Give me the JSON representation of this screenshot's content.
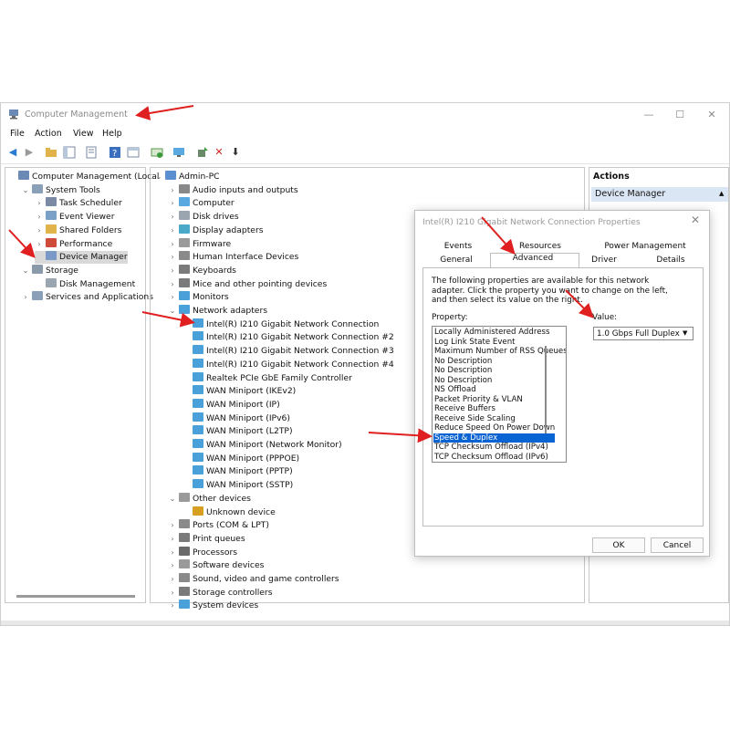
{
  "window": {
    "title": "Computer Management",
    "menu": [
      "File",
      "Action",
      "View",
      "Help"
    ],
    "controls": {
      "minimize": "—",
      "maximize": "☐",
      "close": "✕"
    }
  },
  "left_tree": [
    {
      "label": "Computer Management (Local",
      "indent": 0,
      "twisty": "",
      "icon": "computer-mgmt-icon",
      "color": "#6a8ab5"
    },
    {
      "label": "System Tools",
      "indent": 1,
      "twisty": "⌄",
      "icon": "tools-icon",
      "color": "#8aa0b8"
    },
    {
      "label": "Task Scheduler",
      "indent": 2,
      "twisty": "›",
      "icon": "clock-icon",
      "color": "#7a8aa5"
    },
    {
      "label": "Event Viewer",
      "indent": 2,
      "twisty": "›",
      "icon": "event-viewer-icon",
      "color": "#7aa0c8"
    },
    {
      "label": "Shared Folders",
      "indent": 2,
      "twisty": "›",
      "icon": "shared-folder-icon",
      "color": "#e0b44a"
    },
    {
      "label": "Performance",
      "indent": 2,
      "twisty": "›",
      "icon": "performance-icon",
      "color": "#d04a3a"
    },
    {
      "label": "Device Manager",
      "indent": 2,
      "twisty": "",
      "icon": "device-manager-icon",
      "color": "#7a9ac5",
      "selected": true
    },
    {
      "label": "Storage",
      "indent": 1,
      "twisty": "⌄",
      "icon": "storage-icon",
      "color": "#8a9aaa"
    },
    {
      "label": "Disk Management",
      "indent": 2,
      "twisty": "",
      "icon": "disk-icon",
      "color": "#9aa5b0"
    },
    {
      "label": "Services and Applications",
      "indent": 1,
      "twisty": "›",
      "icon": "services-icon",
      "color": "#8aa0b8"
    }
  ],
  "device_tree": [
    {
      "label": "Admin-PC",
      "indent": 0,
      "twisty": "⌄",
      "icon": "computer-icon",
      "color": "#5a8fd0"
    },
    {
      "label": "Audio inputs and outputs",
      "indent": 1,
      "twisty": "›",
      "icon": "audio-icon",
      "color": "#888"
    },
    {
      "label": "Computer",
      "indent": 1,
      "twisty": "›",
      "icon": "computer-icon",
      "color": "#5aa8e0"
    },
    {
      "label": "Disk drives",
      "indent": 1,
      "twisty": "›",
      "icon": "disk-icon",
      "color": "#9aa5b0"
    },
    {
      "label": "Display adapters",
      "indent": 1,
      "twisty": "›",
      "icon": "display-icon",
      "color": "#4aa8c8"
    },
    {
      "label": "Firmware",
      "indent": 1,
      "twisty": "›",
      "icon": "firmware-icon",
      "color": "#9a9a9a"
    },
    {
      "label": "Human Interface Devices",
      "indent": 1,
      "twisty": "›",
      "icon": "hid-icon",
      "color": "#8a8a8a"
    },
    {
      "label": "Keyboards",
      "indent": 1,
      "twisty": "›",
      "icon": "keyboard-icon",
      "color": "#7a7a7a"
    },
    {
      "label": "Mice and other pointing devices",
      "indent": 1,
      "twisty": "›",
      "icon": "mouse-icon",
      "color": "#7a7a7a"
    },
    {
      "label": "Monitors",
      "indent": 1,
      "twisty": "›",
      "icon": "monitor-icon",
      "color": "#4aa0d8"
    },
    {
      "label": "Network adapters",
      "indent": 1,
      "twisty": "⌄",
      "icon": "network-icon",
      "color": "#4aa0d8"
    },
    {
      "label": "Intel(R) I210 Gigabit Network Connection",
      "indent": 2,
      "twisty": "",
      "icon": "network-icon",
      "color": "#4aa0d8"
    },
    {
      "label": "Intel(R) I210 Gigabit Network Connection #2",
      "indent": 2,
      "twisty": "",
      "icon": "network-icon",
      "color": "#4aa0d8"
    },
    {
      "label": "Intel(R) I210 Gigabit Network Connection #3",
      "indent": 2,
      "twisty": "",
      "icon": "network-icon",
      "color": "#4aa0d8"
    },
    {
      "label": "Intel(R) I210 Gigabit Network Connection #4",
      "indent": 2,
      "twisty": "",
      "icon": "network-icon",
      "color": "#4aa0d8"
    },
    {
      "label": "Realtek PCIe GbE Family Controller",
      "indent": 2,
      "twisty": "",
      "icon": "network-icon",
      "color": "#4aa0d8"
    },
    {
      "label": "WAN Miniport (IKEv2)",
      "indent": 2,
      "twisty": "",
      "icon": "network-icon",
      "color": "#4aa0d8"
    },
    {
      "label": "WAN Miniport (IP)",
      "indent": 2,
      "twisty": "",
      "icon": "network-icon",
      "color": "#4aa0d8"
    },
    {
      "label": "WAN Miniport (IPv6)",
      "indent": 2,
      "twisty": "",
      "icon": "network-icon",
      "color": "#4aa0d8"
    },
    {
      "label": "WAN Miniport (L2TP)",
      "indent": 2,
      "twisty": "",
      "icon": "network-icon",
      "color": "#4aa0d8"
    },
    {
      "label": "WAN Miniport (Network Monitor)",
      "indent": 2,
      "twisty": "",
      "icon": "network-icon",
      "color": "#4aa0d8"
    },
    {
      "label": "WAN Miniport (PPPOE)",
      "indent": 2,
      "twisty": "",
      "icon": "network-icon",
      "color": "#4aa0d8"
    },
    {
      "label": "WAN Miniport (PPTP)",
      "indent": 2,
      "twisty": "",
      "icon": "network-icon",
      "color": "#4aa0d8"
    },
    {
      "label": "WAN Miniport (SSTP)",
      "indent": 2,
      "twisty": "",
      "icon": "network-icon",
      "color": "#4aa0d8"
    },
    {
      "label": "Other devices",
      "indent": 1,
      "twisty": "⌄",
      "icon": "other-devices-icon",
      "color": "#9a9a9a"
    },
    {
      "label": "Unknown device",
      "indent": 2,
      "twisty": "",
      "icon": "unknown-device-icon",
      "color": "#d8a020"
    },
    {
      "label": "Ports (COM & LPT)",
      "indent": 1,
      "twisty": "›",
      "icon": "port-icon",
      "color": "#8a8a8a"
    },
    {
      "label": "Print queues",
      "indent": 1,
      "twisty": "›",
      "icon": "printer-icon",
      "color": "#7a7a7a"
    },
    {
      "label": "Processors",
      "indent": 1,
      "twisty": "›",
      "icon": "processor-icon",
      "color": "#6a6a6a"
    },
    {
      "label": "Software devices",
      "indent": 1,
      "twisty": "›",
      "icon": "software-device-icon",
      "color": "#9a9a9a"
    },
    {
      "label": "Sound, video and game controllers",
      "indent": 1,
      "twisty": "›",
      "icon": "sound-icon",
      "color": "#8a8a8a"
    },
    {
      "label": "Storage controllers",
      "indent": 1,
      "twisty": "›",
      "icon": "storage-controller-icon",
      "color": "#7a7a7a"
    },
    {
      "label": "System devices",
      "indent": 1,
      "twisty": "›",
      "icon": "system-device-icon",
      "color": "#4aa0d8"
    }
  ],
  "actions": {
    "title": "Actions",
    "item": "Device Manager",
    "item_arrow": "▲"
  },
  "dialog": {
    "title": "Intel(R) I210 Gigabit Network Connection Properties",
    "close": "✕",
    "tabs_row1": [
      "Events",
      "Resources",
      "Power Management"
    ],
    "tabs_row2": [
      "General",
      "Advanced",
      "Driver",
      "Details"
    ],
    "active_tab": "Advanced",
    "description": "The following properties are available for this network adapter. Click the property you want to change on the left, and then select its value on the right.",
    "property_label": "Property:",
    "value_label": "Value:",
    "properties": [
      "Locally Administered Address",
      "Log Link State Event",
      "Maximum Number of RSS Queues",
      "No Description",
      "No Description",
      "No Description",
      "NS Offload",
      "Packet Priority & VLAN",
      "Receive Buffers",
      "Receive Side Scaling",
      "Reduce Speed On Power Down",
      "Speed & Duplex",
      "TCP Checksum Offload (IPv4)",
      "TCP Checksum Offload (IPv6)"
    ],
    "selected_property": "Speed & Duplex",
    "value": "1.0 Gbps Full Duplex",
    "ok_label": "OK",
    "cancel_label": "Cancel"
  },
  "colors": {
    "selection": "#0a63d3",
    "annotation_arrow": "#e02020"
  }
}
